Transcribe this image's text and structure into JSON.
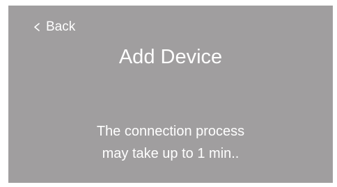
{
  "header": {
    "back_label": "Back",
    "back_icon": "chevron-left-icon",
    "title": "Add Device"
  },
  "main": {
    "message_lines": [
      "The connection process",
      "may take up to 1 min.."
    ]
  },
  "colors": {
    "screen_background": "#a09e9f",
    "text": "#ffffff"
  }
}
